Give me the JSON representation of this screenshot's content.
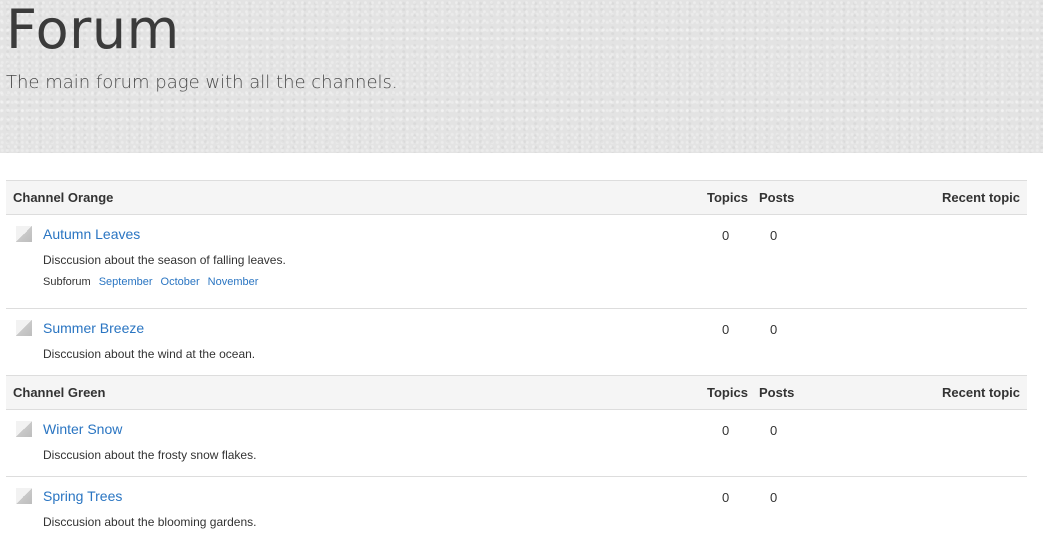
{
  "header": {
    "title": "Forum",
    "subtitle": "The main forum page with all the channels."
  },
  "columns": {
    "topics": "Topics",
    "posts": "Posts",
    "recent": "Recent topic"
  },
  "channels": [
    {
      "name": "Channel Orange",
      "forums": [
        {
          "title": "Autumn Leaves",
          "description": "Disccusion about the season of falling leaves.",
          "topics": "0",
          "posts": "0",
          "subforum_label": "Subforum",
          "subforums": [
            "September",
            "October",
            "November"
          ],
          "icon": "forum-icon"
        },
        {
          "title": "Summer Breeze",
          "description": "Disccusion about the wind at the ocean.",
          "topics": "0",
          "posts": "0",
          "icon": "forum-icon"
        }
      ]
    },
    {
      "name": "Channel Green",
      "forums": [
        {
          "title": "Winter Snow",
          "description": "Disccusion about the frosty snow flakes.",
          "topics": "0",
          "posts": "0",
          "icon": "forum-icon"
        },
        {
          "title": "Spring Trees",
          "description": "Disccusion about the blooming gardens.",
          "topics": "0",
          "posts": "0",
          "icon": "forum-icon"
        }
      ]
    }
  ],
  "colors": {
    "link": "#2a75c2",
    "header_bg": "#e3e3e3",
    "row_head_bg": "#f5f5f5"
  }
}
